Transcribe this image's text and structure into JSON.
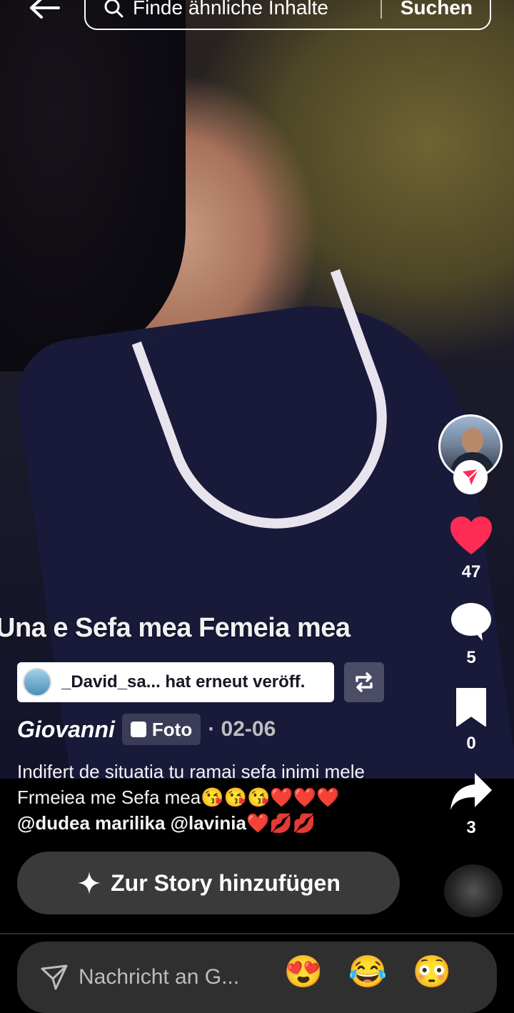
{
  "search": {
    "placeholder": "Finde ähnliche Inhalte",
    "button": "Suchen"
  },
  "overlay": {
    "text": "Una e Sefa mea Femeia mea"
  },
  "rail": {
    "likes": "47",
    "comments": "5",
    "saves": "0",
    "shares": "3"
  },
  "repost": {
    "text": "_David_sa... hat erneut veröff."
  },
  "post": {
    "author": "Giovanni",
    "type": "Foto",
    "date": "· 02-06",
    "caption_part1": "Indifert de situatia tu ramai sefa inimi mele Frmeiea me Sefa mea😘😘😘❤️❤️❤️",
    "mention1": "@dudea marilika",
    "mention2": "@lavinia",
    "caption_end": "❤️💋💋"
  },
  "story_button": {
    "label": "Zur Story hinzufügen"
  },
  "message": {
    "placeholder": "Nachricht an G...",
    "emojis": [
      "😍",
      "😂",
      "😳"
    ]
  },
  "colors": {
    "like": "#fe2c55",
    "background": "#000000"
  }
}
